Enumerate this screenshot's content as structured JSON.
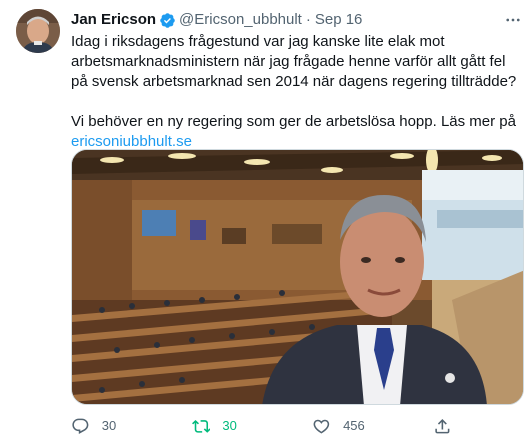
{
  "tweet": {
    "author_name": "Jan Ericson",
    "handle": "@Ericson_ubbhult",
    "separator": "·",
    "date": "Sep 16",
    "verified": true,
    "body_paragraph_1": "Idag i riksdagens frågestund var jag kanske lite elak mot arbetsmarknadsministern när jag frågade henne varför allt gått fel på svensk arbetsmarknad sen 2014 när dagens regering tillträdde?",
    "body_paragraph_2": "Vi behöver en ny regering som ger de arbetslösa hopp. Läs mer på",
    "link_text": "ericsoniubbhult.se"
  },
  "actions": {
    "reply_count": "30",
    "retweet_count": "30",
    "like_count": "456"
  },
  "colors": {
    "accent": "#1d9bf0",
    "retweet_active": "#00ba7c",
    "secondary_text": "#536471"
  },
  "icons": {
    "verified": "verified-badge-icon",
    "more": "more-dots-icon",
    "reply": "reply-icon",
    "retweet": "retweet-icon",
    "like": "heart-icon",
    "share": "share-icon"
  }
}
